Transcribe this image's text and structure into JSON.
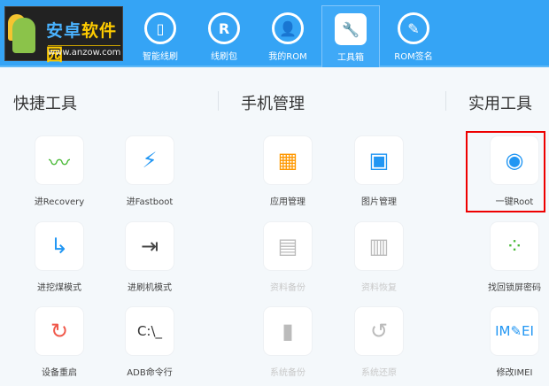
{
  "logo": {
    "name_a": "安卓",
    "name_b": "软件园",
    "url": "www.anzow.com"
  },
  "nav": [
    {
      "label": "智能线刷",
      "icon": "phone-refresh-icon",
      "glyph": "▯"
    },
    {
      "label": "线刷包",
      "icon": "cloud-download-icon",
      "glyph": "R"
    },
    {
      "label": "我的ROM",
      "icon": "user-icon",
      "glyph": "👤"
    },
    {
      "label": "工具箱",
      "icon": "wrench-icon",
      "glyph": "🔧"
    },
    {
      "label": "ROM签名",
      "icon": "pen-icon",
      "glyph": "✎"
    }
  ],
  "sections": [
    "快捷工具",
    "手机管理",
    "实用工具"
  ],
  "tools": [
    {
      "label": "进Recovery",
      "icon": "wave-arrow-icon",
      "glyph": "〰",
      "color": "#4cbb3a",
      "disabled": false
    },
    {
      "label": "进Fastboot",
      "icon": "lightning-icon",
      "glyph": "⚡",
      "color": "#2196f3",
      "disabled": false
    },
    {
      "label": "应用管理",
      "icon": "apps-grid-icon",
      "glyph": "▦",
      "color": "#ff9800",
      "disabled": false
    },
    {
      "label": "图片管理",
      "icon": "image-icon",
      "glyph": "▣",
      "color": "#2196f3",
      "disabled": false
    },
    {
      "label": "一键Root",
      "icon": "keyhole-icon",
      "glyph": "◉",
      "color": "#2196f3",
      "disabled": false
    },
    {
      "label": "进挖煤模式",
      "icon": "arrow-turn-icon",
      "glyph": "↳",
      "color": "#2196f3",
      "disabled": false
    },
    {
      "label": "进刷机模式",
      "icon": "phone-enter-icon",
      "glyph": "⇥",
      "color": "#444",
      "disabled": false
    },
    {
      "label": "资料备份",
      "icon": "document-backup-icon",
      "glyph": "▤",
      "color": "#bbb",
      "disabled": true
    },
    {
      "label": "资料恢复",
      "icon": "document-restore-icon",
      "glyph": "▥",
      "color": "#bbb",
      "disabled": true
    },
    {
      "label": "找回锁屏密码",
      "icon": "pattern-lock-icon",
      "glyph": "⁘",
      "color": "#4cbb3a",
      "disabled": false
    },
    {
      "label": "设备重启",
      "icon": "restart-icon",
      "glyph": "↻",
      "color": "#f0584a",
      "disabled": false
    },
    {
      "label": "ADB命令行",
      "icon": "terminal-icon",
      "glyph": "C:\\_",
      "color": "#333",
      "disabled": false
    },
    {
      "label": "系统备份",
      "icon": "system-backup-icon",
      "glyph": "▮",
      "color": "#bbb",
      "disabled": true
    },
    {
      "label": "系统还原",
      "icon": "history-icon",
      "glyph": "↺",
      "color": "#bbb",
      "disabled": true
    },
    {
      "label": "修改IMEI",
      "icon": "imei-edit-icon",
      "glyph": "IM✎EI",
      "color": "#2196f3",
      "disabled": false
    }
  ]
}
